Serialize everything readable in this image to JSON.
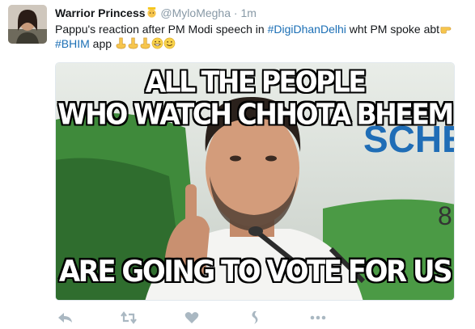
{
  "tweet": {
    "author_name": "Warrior Princess",
    "author_emoji": "princess-emoji",
    "handle": "@MyloMegha",
    "separator": "·",
    "time": "1m",
    "text_part1": "Pappu's reaction after PM Modi speech in ",
    "hashtag1": "#DigiDhanDelhi",
    "text_part2": " wht PM spoke abt",
    "hashtag2": "#BHIM",
    "text_part3": " app"
  },
  "media": {
    "caption_top_line1": "ALL THE PEOPLE",
    "caption_top_line2": "WHO WATCH CHHOTA BHEEM",
    "caption_bottom": "ARE GOING TO VOTE FOR US",
    "background_sign_text": "SCHE",
    "background_sign_digit": "8"
  },
  "actions": {
    "icons": [
      "reply-icon",
      "retweet-icon",
      "like-icon",
      "moments-icon",
      "more-icon"
    ]
  },
  "colors": {
    "hashtag": "#1b6fb5",
    "muted": "#8899a6",
    "text": "#14171a",
    "action_icon": "#aab8c2"
  }
}
